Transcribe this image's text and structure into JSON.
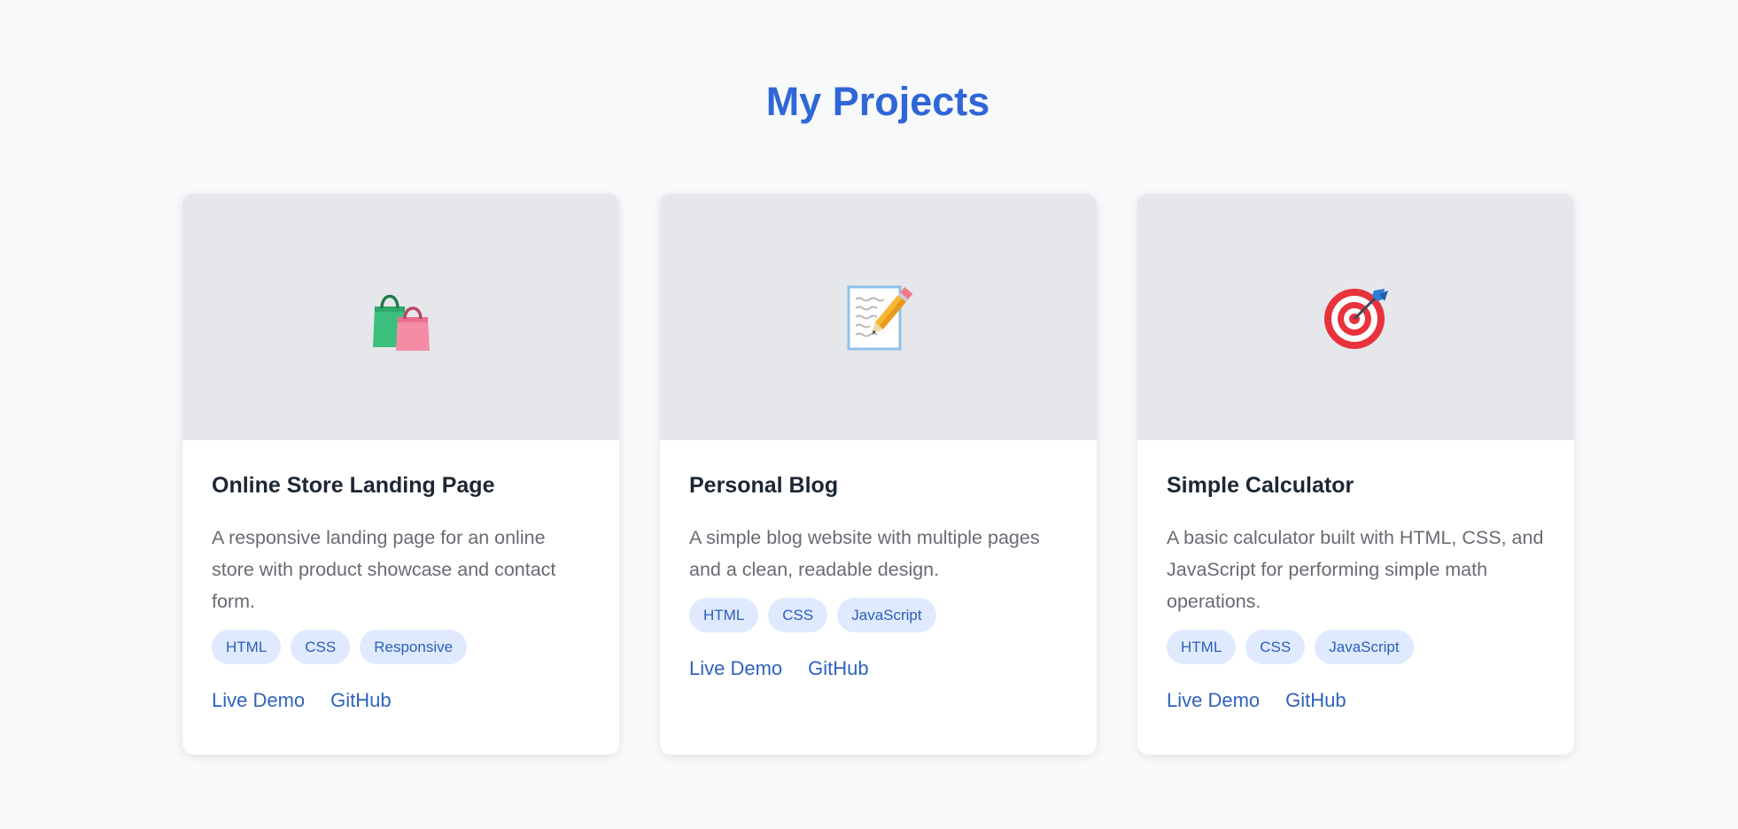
{
  "page": {
    "title": "My Projects"
  },
  "colors": {
    "accent": "#2f66d8",
    "tag_bg": "#dfeaff",
    "tag_text": "#2c5fb9",
    "card_image_bg": "#e6e7ea"
  },
  "projects": [
    {
      "icon": "shopping-bags-icon",
      "title": "Online Store Landing Page",
      "description": "A responsive landing page for an online store with product showcase and contact form.",
      "tags": [
        "HTML",
        "CSS",
        "Responsive"
      ],
      "links": {
        "demo": "Live Demo",
        "github": "GitHub"
      }
    },
    {
      "icon": "memo-icon",
      "title": "Personal Blog",
      "description": "A simple blog website with multiple pages and a clean, readable design.",
      "tags": [
        "HTML",
        "CSS",
        "JavaScript"
      ],
      "links": {
        "demo": "Live Demo",
        "github": "GitHub"
      }
    },
    {
      "icon": "target-icon",
      "title": "Simple Calculator",
      "description": "A basic calculator built with HTML, CSS, and JavaScript for performing simple math operations.",
      "tags": [
        "HTML",
        "CSS",
        "JavaScript"
      ],
      "links": {
        "demo": "Live Demo",
        "github": "GitHub"
      }
    }
  ]
}
